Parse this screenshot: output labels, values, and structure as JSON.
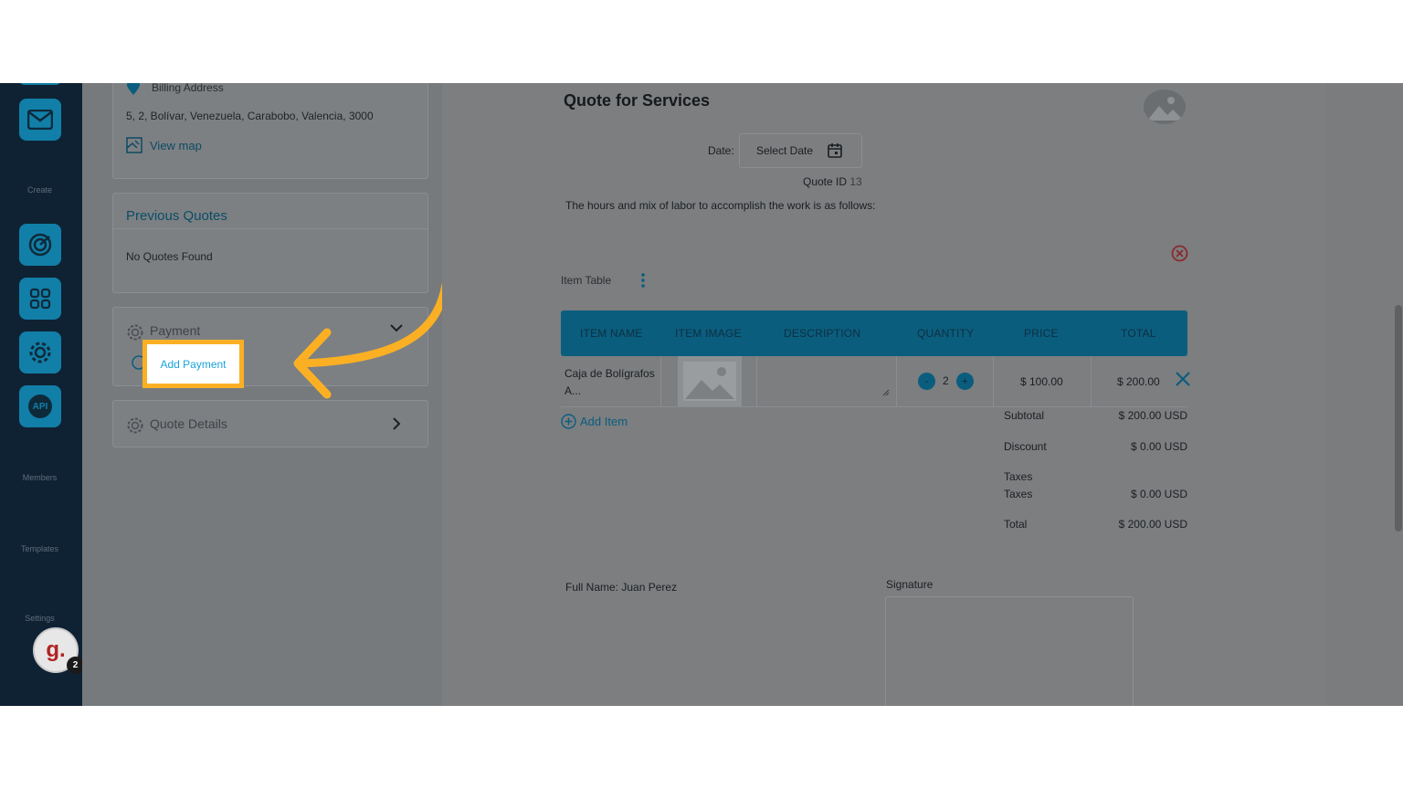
{
  "sidebar": {
    "labels": {
      "create": "Create",
      "members": "Members",
      "templates": "Templates",
      "settings": "Settings"
    },
    "icons": [
      "mail-icon",
      "target-icon",
      "grid-icon",
      "gear-icon",
      "api-icon"
    ],
    "api_text": "API",
    "avatar_letter": "g.",
    "avatar_badge": "2"
  },
  "left_panel": {
    "billing_label": "Billing Address",
    "billing_address": "5, 2, Bolívar, Venezuela, Carabobo, Valencia, 3000",
    "view_map": "View map",
    "previous_quotes_title": "Previous Quotes",
    "previous_quotes_empty": "No Quotes Found",
    "payment_title": "Payment",
    "add_payment": "Add Payment",
    "quote_details_title": "Quote Details"
  },
  "document": {
    "title": "Quote for Services",
    "date_label": "Date:",
    "date_placeholder": "Select Date",
    "quote_id_label": "Quote ID",
    "quote_id_value": "13",
    "intro": "The hours and mix of labor to accomplish the work is as follows:",
    "item_table_label": "Item Table",
    "columns": [
      "ITEM NAME",
      "ITEM IMAGE",
      "DESCRIPTION",
      "QUANTITY",
      "PRICE",
      "TOTAL"
    ],
    "items": [
      {
        "name_line1": "Caja de Bolígrafos",
        "name_line2": "A...",
        "quantity": "2",
        "price": "$ 100.00",
        "total": "$ 200.00"
      }
    ],
    "qty_minus": "-",
    "qty_plus": "+",
    "add_item": "Add Item",
    "totals": {
      "subtotal_label": "Subtotal",
      "subtotal": "$ 200.00 USD",
      "discount_label": "Discount",
      "discount": "$ 0.00 USD",
      "taxes_header": "Taxes",
      "taxes_label": "Taxes",
      "taxes": "$ 0.00 USD",
      "total_label": "Total",
      "total": "$ 200.00 USD"
    },
    "full_name_label": "Full Name:",
    "full_name_value": "Juan Perez",
    "signature_label": "Signature"
  },
  "colors": {
    "accent": "#1aa3d9",
    "highlight_border": "#fbb024",
    "sidebar_bg": "#0f2233",
    "rail_button": "#117fa8"
  }
}
